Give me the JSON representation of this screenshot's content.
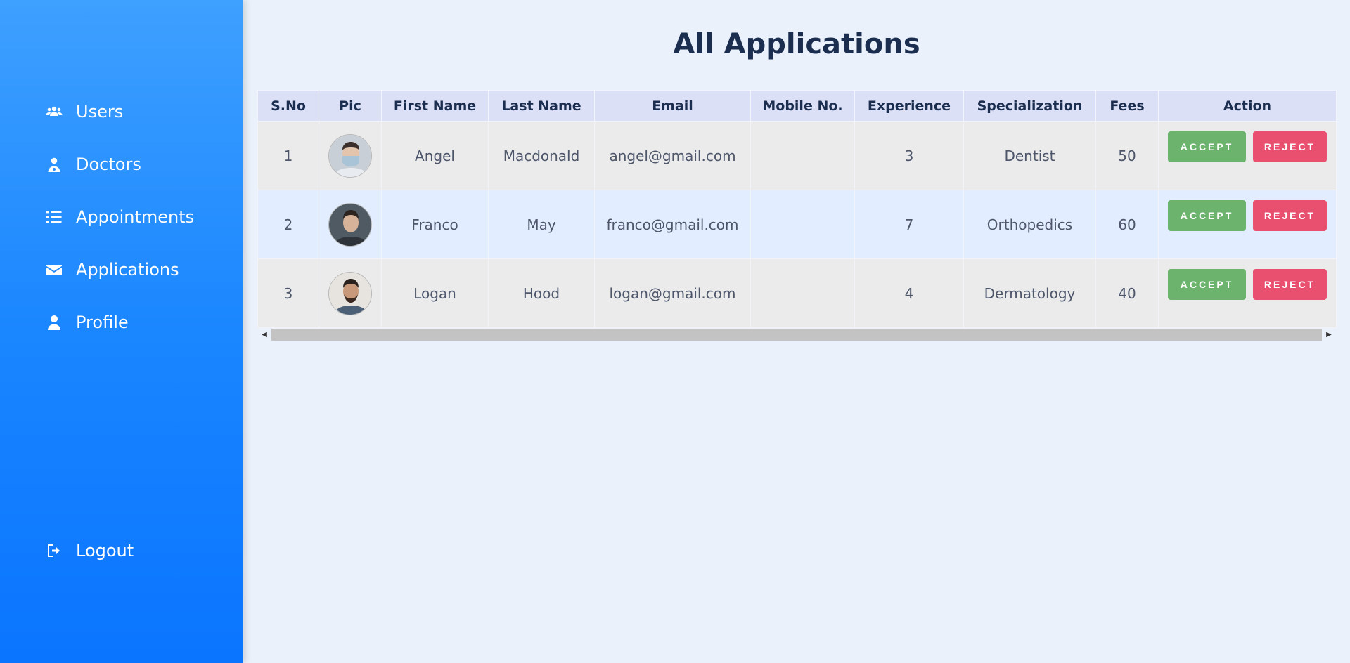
{
  "sidebar": {
    "items": [
      {
        "label": "Users",
        "icon": "users-icon"
      },
      {
        "label": "Doctors",
        "icon": "doctor-icon"
      },
      {
        "label": "Appointments",
        "icon": "list-icon"
      },
      {
        "label": "Applications",
        "icon": "envelope-icon"
      },
      {
        "label": "Profile",
        "icon": "user-icon"
      }
    ],
    "logout": {
      "label": "Logout",
      "icon": "logout-icon"
    }
  },
  "page": {
    "title": "All Applications"
  },
  "table": {
    "headers": [
      "S.No",
      "Pic",
      "First Name",
      "Last Name",
      "Email",
      "Mobile No.",
      "Experience",
      "Specialization",
      "Fees",
      "Action"
    ],
    "rows": [
      {
        "sno": "1",
        "first": "Angel",
        "last": "Macdonald",
        "email": "angel@gmail.com",
        "mobile": "",
        "experience": "3",
        "specialization": "Dentist",
        "fees": "50"
      },
      {
        "sno": "2",
        "first": "Franco",
        "last": "May",
        "email": "franco@gmail.com",
        "mobile": "",
        "experience": "7",
        "specialization": "Orthopedics",
        "fees": "60"
      },
      {
        "sno": "3",
        "first": "Logan",
        "last": "Hood",
        "email": "logan@gmail.com",
        "mobile": "",
        "experience": "4",
        "specialization": "Dermatology",
        "fees": "40"
      }
    ],
    "accept_label": "ACCEPT",
    "reject_label": "REJECT"
  },
  "colors": {
    "accent": "#1a86ff",
    "accept": "#6cb46d",
    "reject": "#e9506f",
    "title": "#1b2e4f"
  }
}
